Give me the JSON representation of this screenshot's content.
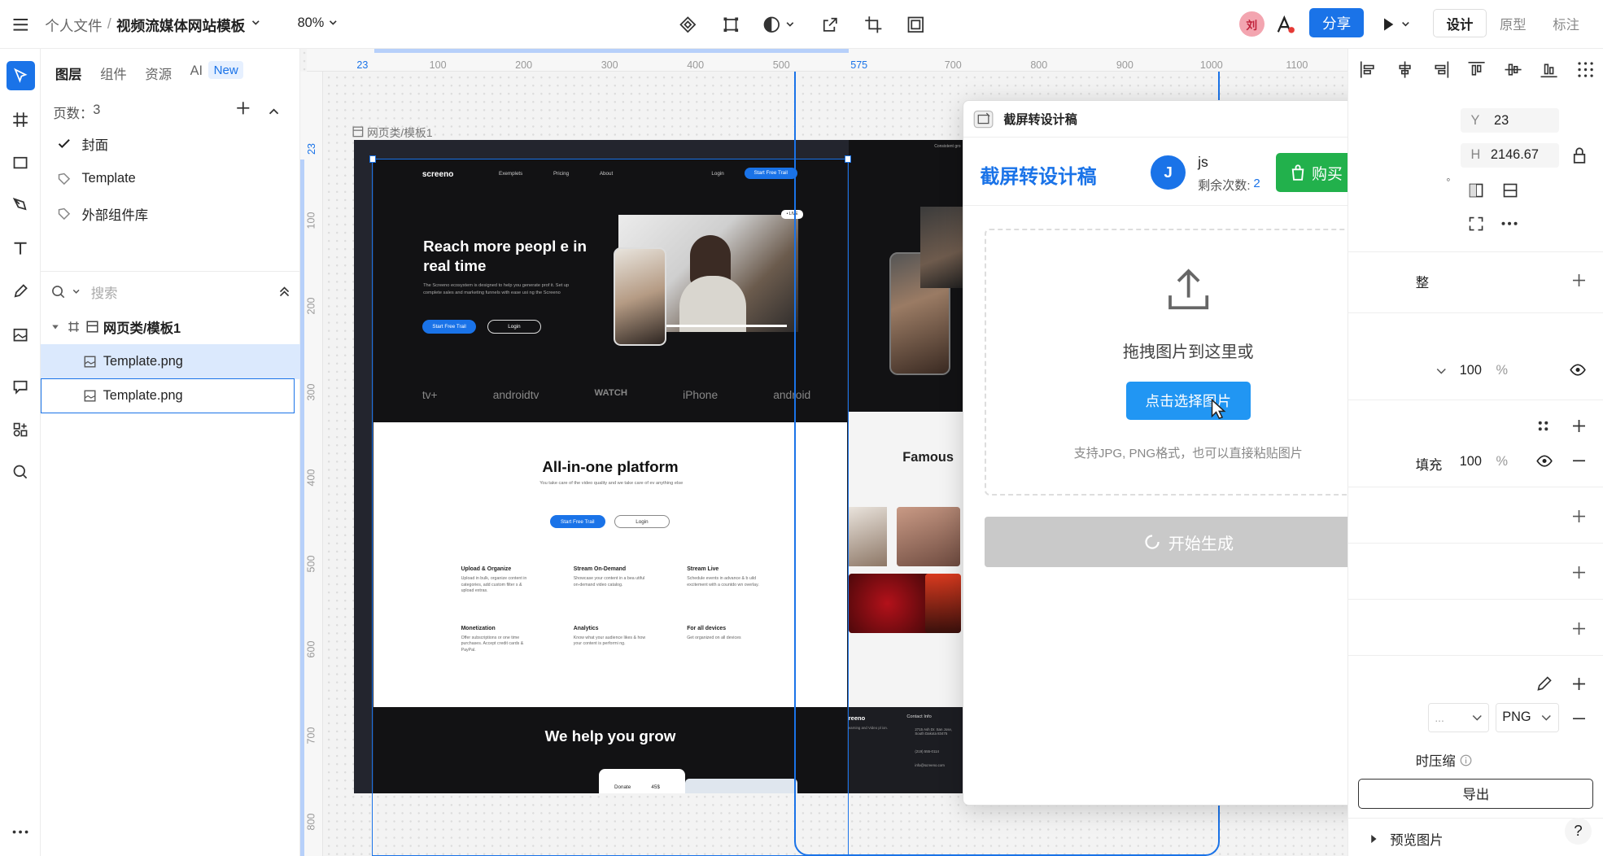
{
  "topbar": {
    "breadcrumb_root": "个人文件",
    "breadcrumb_sep": "/",
    "file_title": "视频流媒体网站模板",
    "zoom": "80%",
    "avatar_letter": "刘",
    "share_label": "分享",
    "modes": [
      "设计",
      "原型",
      "标注"
    ]
  },
  "tabs": {
    "layers": "图层",
    "components": "组件",
    "assets": "资源",
    "ai": "AI",
    "new_badge": "New"
  },
  "pages": {
    "count_label": "页数：",
    "count": "3",
    "items": [
      "封面",
      "Template",
      "外部组件库"
    ]
  },
  "search": {
    "placeholder": "搜索"
  },
  "tree": {
    "frame": "网页类/模板1",
    "children": [
      "Template.png",
      "Template.png"
    ]
  },
  "ruler": {
    "h": [
      "23",
      "100",
      "200",
      "300",
      "400",
      "500",
      "575",
      "700",
      "800",
      "900",
      "1000",
      "1100"
    ],
    "v": [
      "23",
      "100",
      "200",
      "300",
      "400",
      "500",
      "600",
      "700",
      "800"
    ]
  },
  "canvas": {
    "frame_label": "网页类/模板1"
  },
  "site": {
    "logo": "screeno",
    "nav": [
      "Exemplets",
      "Pricing",
      "About"
    ],
    "login": "Login",
    "cta": "Start Free Trail",
    "hero_title": "Reach more peopl e in real time",
    "hero_desc": "The Screeno ecosystem is designed to help you generate prof it. Set up complete sales and marketing funnels with ease usi ng the Screeno",
    "btn_trial": "Start Free Trail",
    "btn_login": "Login",
    "live": "• LIVE",
    "brands": [
      "tv+",
      "androidtv",
      "WATCH",
      "iPhone",
      "android"
    ],
    "platform_title": "All-in-one platform",
    "platform_desc": "You take care of the video quality and we take care of ev anything else",
    "features": [
      {
        "t": "Upload & Organize",
        "d": "Upload in bulk, organize content in categories, add custom filter s & upload extras."
      },
      {
        "t": "Stream On-Demand",
        "d": "Showcase your content in a bea utiful on-demand video catalog."
      },
      {
        "t": "Stream Live",
        "d": "Schedule events in advance & b uild excitement with a countdo wn overlay."
      },
      {
        "t": "Monetization",
        "d": "Offer subscriptions or one time purchases. Accept credit cards & PayPal."
      },
      {
        "t": "Analytics",
        "d": "Know what your audience likes & how your content is performi ng."
      },
      {
        "t": "For all devices",
        "d": "Get organized on all devices"
      }
    ],
    "grow_title": "We help you grow",
    "donate": "Donate",
    "donate_val": "45$",
    "famous": "Famous",
    "contact_title": "Contact Info",
    "contact_addr": "2715 Ash Dr. San Jose, South Dakota 83475",
    "contact_phone": "(219) 555-0114",
    "contact_email": "info@screeno.com",
    "footer_logo": "reeno",
    "footer_desc": "earning and Video pl ion.",
    "top_right_text": "Consistent gro"
  },
  "dialog": {
    "header": "截屏转设计稿",
    "title": "截屏转设计稿",
    "user_initial": "J",
    "user_name": "js",
    "remaining_label": "剩余次数:",
    "remaining": "2",
    "buy": "购买",
    "drop_text": "拖拽图片到这里或",
    "choose": "点击选择图片",
    "hint": "支持JPG, PNG格式，也可以直接粘贴图片",
    "generate": "开始生成"
  },
  "props": {
    "y_label": "Y",
    "y": "23",
    "h_label": "H",
    "h": "2146.67",
    "deg": "°",
    "adjust": "整",
    "opacity1": "100",
    "pct": "%",
    "fill_label": "填充",
    "opacity2": "100",
    "export_dots": "...",
    "format": "PNG",
    "compress": "时压缩",
    "export_btn": "导出",
    "preview": "预览图片",
    "help": "?"
  }
}
